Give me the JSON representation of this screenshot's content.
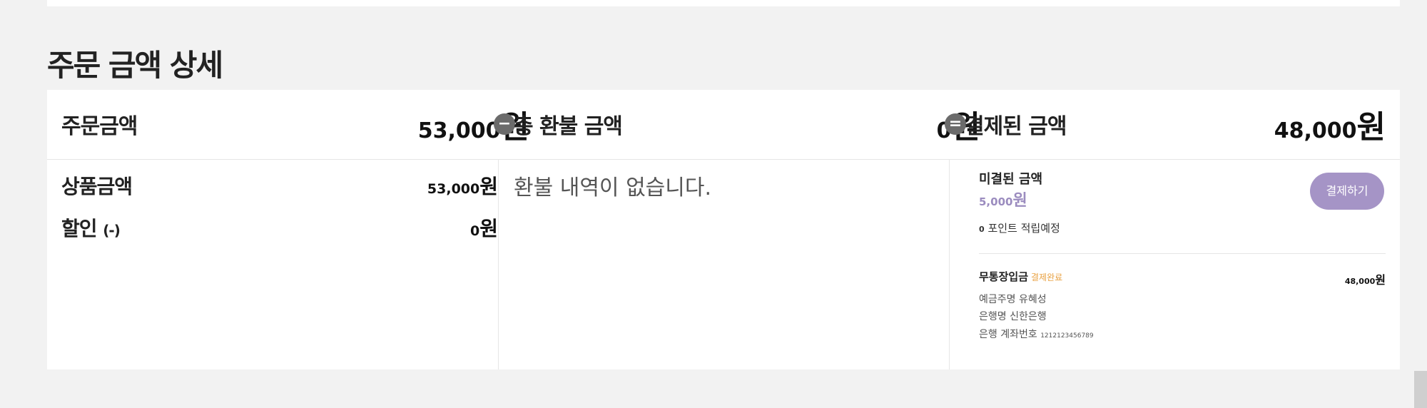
{
  "section": {
    "title": "주문 금액 상세"
  },
  "summary": {
    "order": {
      "label": "주문금액",
      "amount": "53,000",
      "unit": "원"
    },
    "refund": {
      "operator": "−",
      "label": "총 환불 금액",
      "amount": "0",
      "unit": "원"
    },
    "paid": {
      "operator": "=",
      "label": "결제된 금액",
      "amount": "48,000",
      "unit": "원"
    }
  },
  "breakdown": {
    "product": {
      "label": "상품금액",
      "amount": "53,000",
      "unit": "원"
    },
    "discount": {
      "label": "할인",
      "suffix": "(-)",
      "amount": "0",
      "unit": "원"
    }
  },
  "refund_history": {
    "empty_text": "환불 내역이 없습니다."
  },
  "payment": {
    "unpaid_label": "미결된 금액",
    "unpaid_amount": "5,000",
    "unpaid_unit": "원",
    "pay_button": "결제하기",
    "points_amount": "0",
    "points_text": "포인트 적립예정",
    "method_label": "무통장입금",
    "method_status": "결제완료",
    "method_amount": "48,000",
    "method_unit": "원",
    "depositor_label": "예금주명",
    "depositor_value": "유혜성",
    "bank_label": "은행명",
    "bank_value": "신한은행",
    "account_label": "은행 계좌번호",
    "account_value": "1212123456789"
  },
  "colors": {
    "accent": "#a594c6",
    "unpaid_text": "#9b8cbf",
    "status_badge": "#e8a040"
  }
}
